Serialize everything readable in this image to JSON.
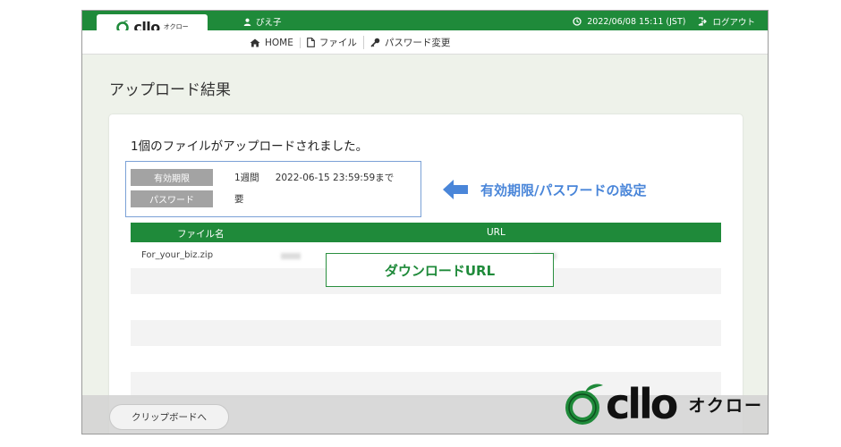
{
  "header": {
    "user": "ぴえ子",
    "datetime": "2022/06/08 15:11 (JST)",
    "logout_label": "ログアウト",
    "logo_word": "cllo",
    "logo_kana": "オクロー"
  },
  "nav": [
    {
      "label": "HOME",
      "icon": "home-icon"
    },
    {
      "label": "ファイル",
      "icon": "file-icon"
    },
    {
      "label": "パスワード変更",
      "icon": "key-icon"
    }
  ],
  "page": {
    "title": "アップロード結果",
    "heading": "1個のファイルがアップロードされました。"
  },
  "info": {
    "expiry_label": "有効期限",
    "expiry_period": "1週間",
    "expiry_date": "2022-06-15 23:59:59まで",
    "password_label": "パスワード",
    "password_value": "要"
  },
  "annotation": {
    "expiry_password": "有効期限/パスワードの設定",
    "download_url": "ダウンロードURL"
  },
  "table": {
    "headers": {
      "name": "ファイル名",
      "url": "URL"
    },
    "rows": [
      {
        "name": "For_your_biz.zip"
      }
    ]
  },
  "footer": {
    "clipboard_button": "クリップボードへ"
  },
  "brand": {
    "word": "cllo",
    "kana": "オクロー"
  },
  "colors": {
    "primary_green": "#1f8a3a",
    "annotation_blue": "#4a86d9",
    "label_gray": "#a3a3a3"
  }
}
